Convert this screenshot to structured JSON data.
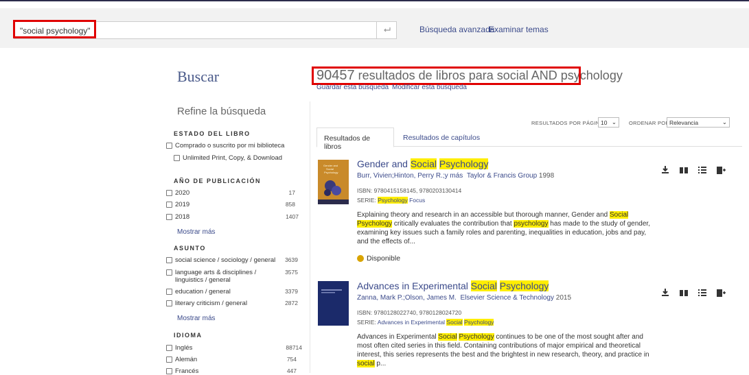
{
  "search": {
    "value": "\"social psychology\"",
    "enter_icon": "return-arrow-icon"
  },
  "toplinks": {
    "advanced": "Búsqueda avanzada",
    "browse": "Examinar temas"
  },
  "page": {
    "heading": "Buscar",
    "results_count": "90457",
    "results_text": " resultados de libros para social AND psychology",
    "save_search": "Guardar esta búsqueda",
    "modify_search": "Modificar esta búsqueda"
  },
  "refine": {
    "title": "Refine la búsqueda",
    "book_status": {
      "heading": "ESTADO DEL LIBRO",
      "items": [
        {
          "label": "Comprado o suscrito por mi biblioteca"
        },
        {
          "label": "Unlimited Print, Copy, & Download"
        }
      ]
    },
    "year": {
      "heading": "AÑO DE PUBLICACIÓN",
      "items": [
        {
          "label": "2020",
          "count": "17"
        },
        {
          "label": "2019",
          "count": "858"
        },
        {
          "label": "2018",
          "count": "1407"
        }
      ],
      "more": "Mostrar más"
    },
    "subject": {
      "heading": "ASUNTO",
      "items": [
        {
          "label": "social science / sociology / general",
          "count": "3639"
        },
        {
          "label": "language arts & disciplines / linguistics / general",
          "count": "3575"
        },
        {
          "label": "education / general",
          "count": "3379"
        },
        {
          "label": "literary criticism / general",
          "count": "2872"
        }
      ],
      "more": "Mostrar más"
    },
    "language": {
      "heading": "IDIOMA",
      "items": [
        {
          "label": "Inglés",
          "count": "88714"
        },
        {
          "label": "Alemán",
          "count": "754"
        },
        {
          "label": "Francés",
          "count": "447"
        }
      ]
    }
  },
  "controls": {
    "per_page_label": "RESULTADOS POR PÁGINA",
    "per_page_value": "10",
    "sort_label": "ORDENAR POR",
    "sort_value": "Relevancia"
  },
  "tabs": {
    "books": "Resultados de libros",
    "chapters": "Resultados de capítulos"
  },
  "results": [
    {
      "title_a": "Gender and ",
      "title_b": "Social",
      "title_c": " ",
      "title_d": "Psychology",
      "authors": "Burr, Vivien;Hinton, Perry R.;y más",
      "publisher": "Taylor & Francis Group",
      "year": "1998",
      "isbn_label": "ISBN:",
      "isbn": "9780415158145, 9780203130414",
      "series_label": "SERIE:",
      "series_a": "",
      "series_hl1": "Psychology",
      "series_b": " Focus",
      "series_hl2": "",
      "series_c": "",
      "series_hl3": "",
      "desc_parts": [
        "Explaining theory and research in an accessible but thorough manner, Gender and ",
        "Social",
        " ",
        "Psychology",
        " critically evaluates the contribution that ",
        "psychology",
        " has made to the study of gender, examining key issues such a family roles and parenting, inequalities in education, jobs and pay, and the effects of..."
      ],
      "availability": "Disponible"
    },
    {
      "title_a": "Advances in Experimental ",
      "title_b": "Social",
      "title_c": " ",
      "title_d": "Psychology",
      "authors": "Zanna, Mark P.;Olson, James M.",
      "publisher": "Elsevier Science & Technology",
      "year": "2015",
      "isbn_label": "ISBN:",
      "isbn": "9780128022740, 9780128024720",
      "series_label": "SERIE:",
      "series_a": "Advances in Experimental ",
      "series_hl1": "Social",
      "series_b": " ",
      "series_hl2": "Psychology",
      "series_c": "",
      "series_hl3": "",
      "desc_parts": [
        "Advances in Experimental ",
        "Social",
        " ",
        "Psychology",
        " continues to be one of the most sought after and most often cited series in this field. Containing contributions of major empirical and theoretical interest, this series represents the best and the brightest in new research, theory, and practice in ",
        "social",
        " p..."
      ]
    }
  ],
  "cover_text": {
    "gender": [
      "Gender and",
      "Social",
      "Psychology"
    ]
  },
  "colors": {
    "link": "#3b4a8a",
    "highlight": "#ffee00",
    "annotation": "#e00000",
    "available": "#d9a400"
  }
}
